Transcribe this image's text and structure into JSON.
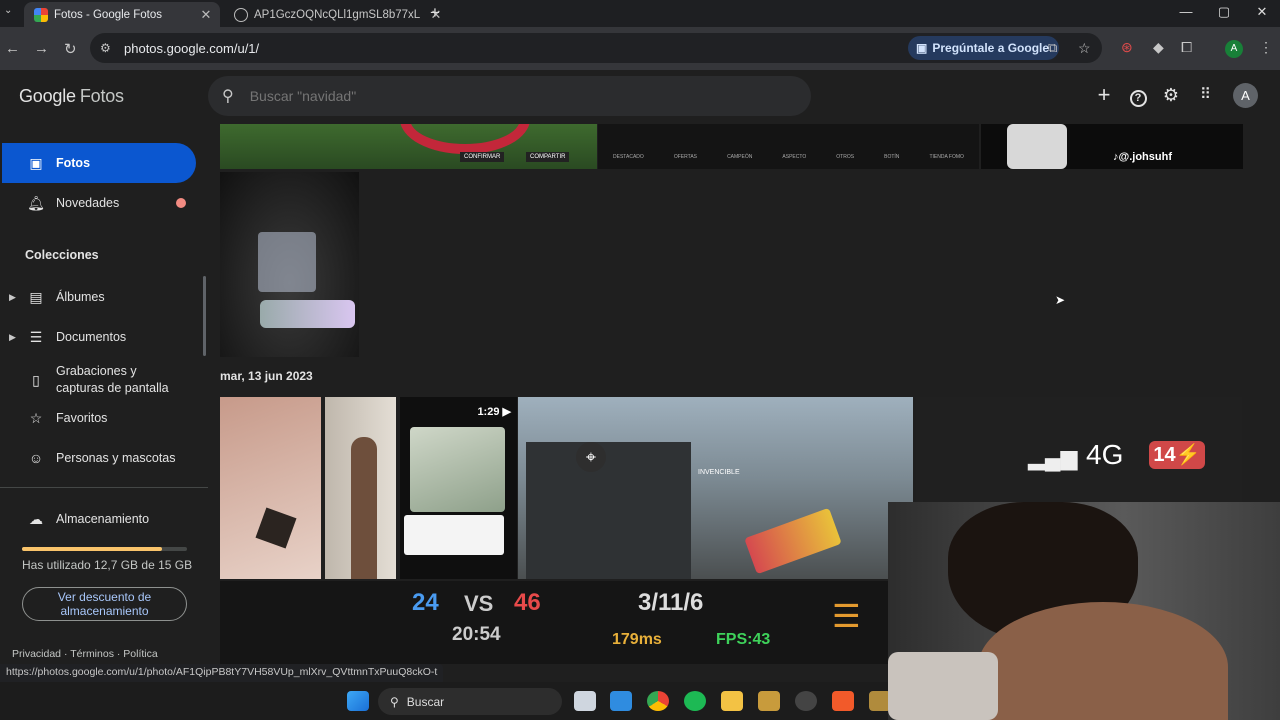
{
  "browser": {
    "tabs": [
      {
        "title": "Fotos - Google Fotos",
        "active": true
      },
      {
        "title": "AP1GczOQNcQLl1gmSL8b77xL",
        "active": false
      }
    ],
    "new_tab": "+",
    "url": "photos.google.com/u/1/",
    "ask_google": "Pregúntale a Google",
    "profile_initial": "A",
    "status_url": "https://photos.google.com/u/1/photo/AF1QipPB8tY7VH58VUp_mlXrv_QVttmnTxPuuQ8ckO-t"
  },
  "app": {
    "logo_google": "Google",
    "logo_fotos": "Fotos",
    "search_placeholder": "Buscar \"navidad\"",
    "avatar_initial": "A"
  },
  "sidebar": {
    "fotos": "Fotos",
    "novedades": "Novedades",
    "colecciones": "Colecciones",
    "albumes": "Álbumes",
    "documentos": "Documentos",
    "grabaciones": "Grabaciones y capturas de pantalla",
    "favoritos": "Favoritos",
    "personas": "Personas y mascotas",
    "almacenamiento": "Almacenamiento",
    "storage_used_text": "Has utilizado 12,7 GB de 15 GB",
    "storage_fraction": 0.847,
    "discount_button": "Ver descuento de almacenamiento",
    "footer_privacy": "Privacidad",
    "footer_terms": "Términos",
    "footer_policy": "Política"
  },
  "main": {
    "date_label": "mar, 13 jun 2023",
    "video_duration": "1:29",
    "game_strip": {
      "confirm": "CONFIRMAR",
      "share": "COMPARTIR",
      "menu": [
        "DESTACADO",
        "OFERTAS",
        "CAMPEÓN",
        "ASPECTO",
        "OTROS",
        "BOTÍN",
        "TIENDA FOMO"
      ],
      "tiktok_handle": "@.johsuhf"
    },
    "phone_status": {
      "network": "4G",
      "battery": "14"
    },
    "game_hud": {
      "team_a": "24",
      "vs": "VS",
      "team_b": "46",
      "kda": "3/11/6",
      "timer": "20:54",
      "ping": "179ms",
      "fps": "FPS:43"
    },
    "overlay_text": "INVENCIBLE"
  },
  "taskbar": {
    "search": "Buscar"
  }
}
